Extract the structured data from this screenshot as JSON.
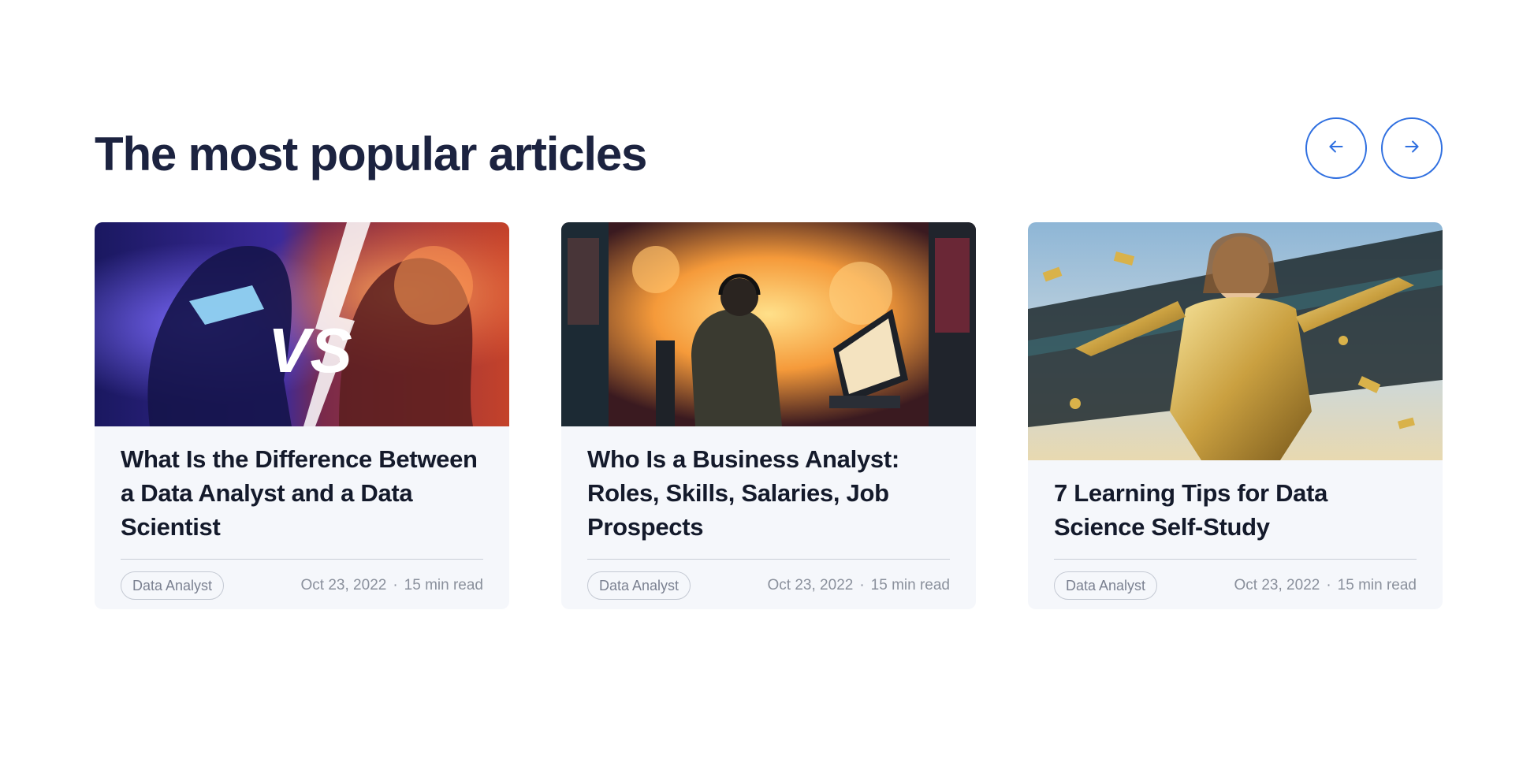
{
  "section": {
    "title": "The most popular articles"
  },
  "nav": {
    "prev_icon": "arrow-left-icon",
    "next_icon": "arrow-right-icon",
    "accent": "#2f6fe0"
  },
  "articles": [
    {
      "title": "What Is the Difference Between a Data Analyst and a Data Scientist",
      "tag": "Data Analyst",
      "date": "Oct 23, 2022",
      "separator": "·",
      "read_time": "15 min read",
      "image_text": "VS"
    },
    {
      "title": "Who Is a Business Analyst: Roles, Skills, Salaries, Job Prospects",
      "tag": "Data Analyst",
      "date": "Oct 23, 2022",
      "separator": "·",
      "read_time": "15 min read"
    },
    {
      "title": "7 Learning Tips for Data Science Self-Study",
      "tag": "Data Analyst",
      "date": "Oct 23, 2022",
      "separator": "·",
      "read_time": "15 min read"
    }
  ]
}
